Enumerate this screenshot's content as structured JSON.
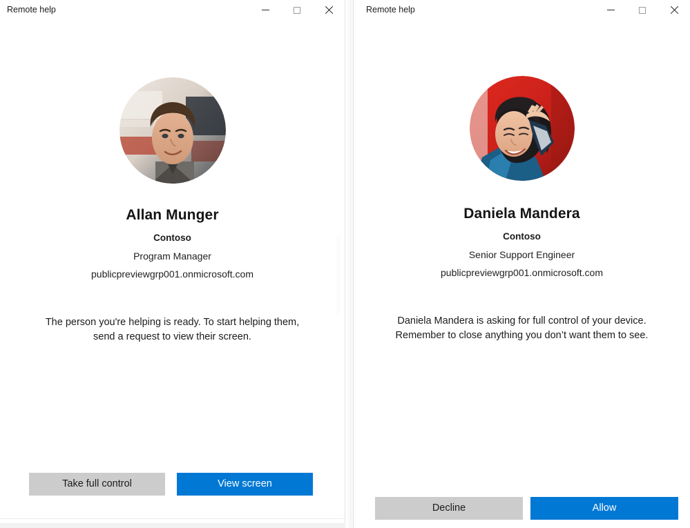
{
  "theme": {
    "accent": "#0078d4",
    "secondary_button": "#cccccc",
    "window_background": "#ffffff",
    "text_primary": "#1b1b1b"
  },
  "windows": [
    {
      "id": "helper",
      "titlebar": {
        "title": "Remote help",
        "minimize_label": "Minimize",
        "maximize_label": "Maximize",
        "close_label": "Close"
      },
      "avatar": {
        "icon": "user-photo-avatar",
        "alt": "Allan Munger profile photo"
      },
      "person": {
        "name": "Allan Munger",
        "organization": "Contoso",
        "job_title": "Program Manager",
        "tenant": "publicpreviewgrp001.onmicrosoft.com"
      },
      "message": "The person you're helping is ready. To start helping them,\nsend a request to view their screen.",
      "buttons": {
        "secondary": "Take full control",
        "primary": "View screen"
      }
    },
    {
      "id": "sharer",
      "titlebar": {
        "title": "Remote help",
        "minimize_label": "Minimize",
        "maximize_label": "Maximize",
        "close_label": "Close"
      },
      "avatar": {
        "icon": "user-photo-avatar",
        "alt": "Daniela Mandera profile photo"
      },
      "person": {
        "name": "Daniela Mandera",
        "organization": "Contoso",
        "job_title": "Senior Support Engineer",
        "tenant": "publicpreviewgrp001.onmicrosoft.com"
      },
      "message": "Daniela Mandera is asking for full control of your device.\nRemember to close anything you don’t want them to see.",
      "buttons": {
        "secondary": "Decline",
        "primary": "Allow"
      }
    }
  ]
}
